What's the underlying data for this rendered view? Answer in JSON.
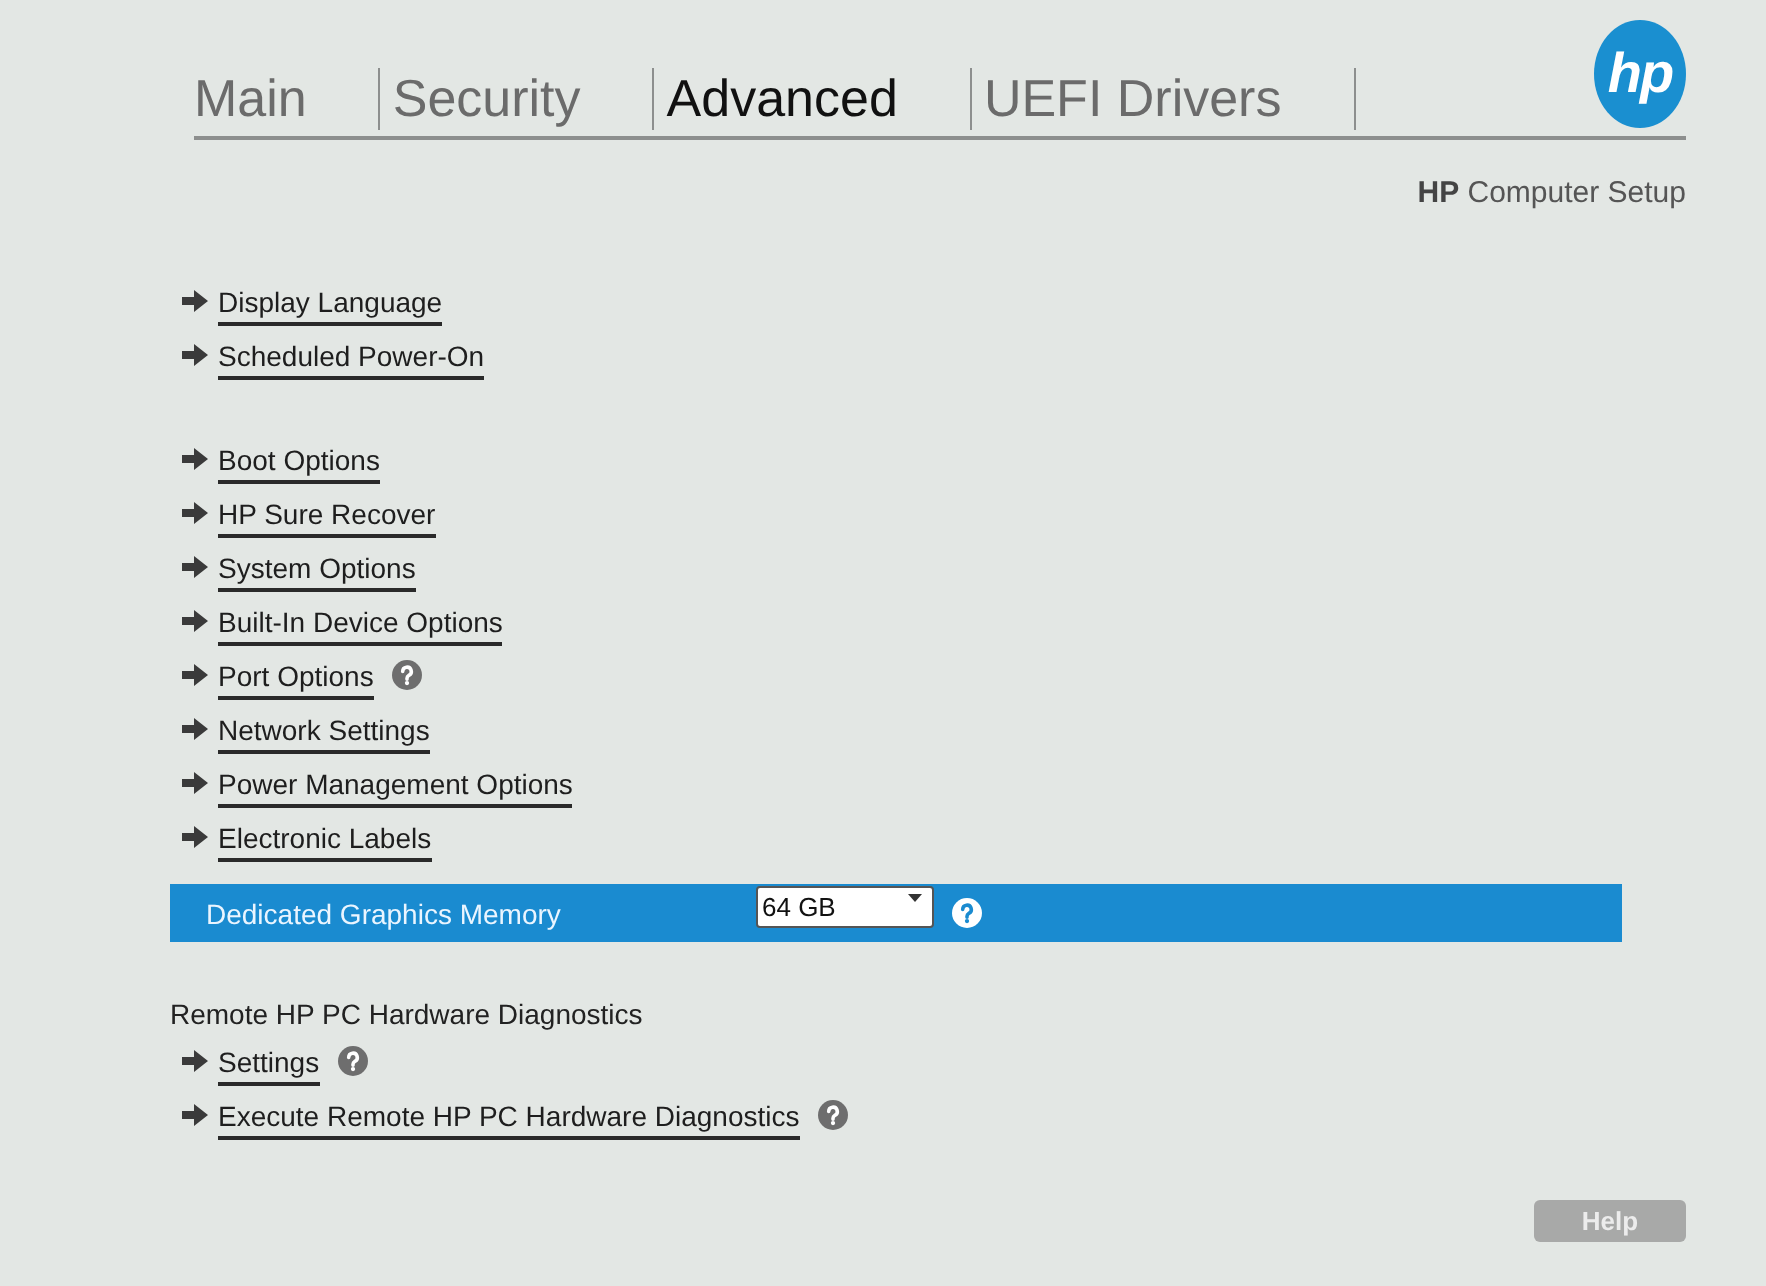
{
  "tabs": [
    {
      "label": "Main",
      "selected": false
    },
    {
      "label": "Security",
      "selected": false
    },
    {
      "label": "Advanced",
      "selected": true
    },
    {
      "label": "UEFI Drivers",
      "selected": false
    }
  ],
  "logo": "hp",
  "subtitle": "**HP** Computer Setup",
  "groups": [
    {
      "items": [
        {
          "kind": "link",
          "label": "Display Language",
          "help": false,
          "selected": false
        },
        {
          "kind": "link",
          "label": "Scheduled Power-On",
          "help": false,
          "selected": false
        }
      ]
    },
    {
      "items": [
        {
          "kind": "link",
          "label": "Boot Options",
          "help": false,
          "selected": false
        },
        {
          "kind": "link",
          "label": "HP Sure Recover",
          "help": false,
          "selected": false
        },
        {
          "kind": "link",
          "label": "System Options",
          "help": false,
          "selected": false
        },
        {
          "kind": "link",
          "label": "Built-In Device Options",
          "help": false,
          "selected": false
        },
        {
          "kind": "link",
          "label": "Port Options",
          "help": true,
          "selected": false
        },
        {
          "kind": "link",
          "label": "Network Settings",
          "help": false,
          "selected": false
        },
        {
          "kind": "link",
          "label": "Power Management Options",
          "help": false,
          "selected": false
        },
        {
          "kind": "link",
          "label": "Electronic Labels",
          "help": false,
          "selected": false
        },
        {
          "kind": "setting",
          "label": "Dedicated Graphics Memory",
          "value": "64 GB",
          "help": true,
          "selected": true
        }
      ]
    },
    {
      "heading": "Remote HP PC Hardware Diagnostics",
      "items": [
        {
          "kind": "link",
          "label": "Settings",
          "help": true,
          "selected": false
        },
        {
          "kind": "link",
          "label": "Execute Remote HP PC Hardware Diagnostics",
          "help": true,
          "selected": false
        }
      ]
    }
  ],
  "help_button": "Help"
}
